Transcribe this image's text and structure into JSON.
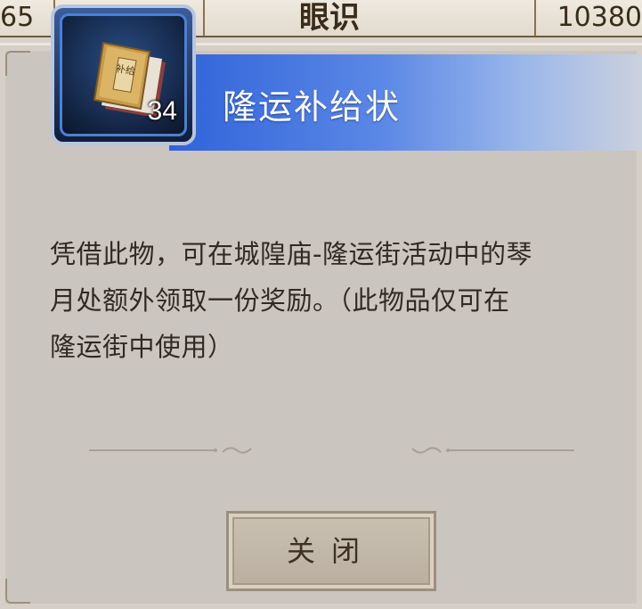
{
  "background": {
    "left_text": "65",
    "mid_text": "眼识",
    "right_text": "10380"
  },
  "item": {
    "name": "隆运补给状",
    "count": "34",
    "book_label": "补给"
  },
  "description": {
    "line1": "凭借此物，可在城隍庙-隆运街活动中的琴",
    "line2": "月处额外领取一份奖励。（此物品仅可在",
    "line3": "隆运街中使用）"
  },
  "close_button": {
    "label": "关闭"
  },
  "colors": {
    "title_blue": "#2f63d9",
    "panel": "#cbc5c0",
    "text": "#322a22"
  }
}
